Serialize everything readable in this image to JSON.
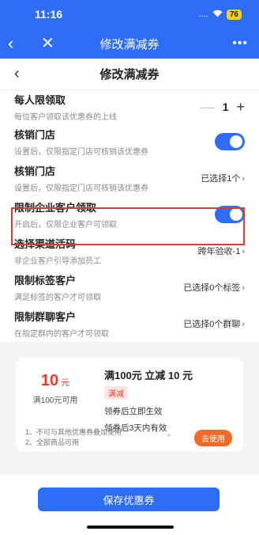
{
  "status": {
    "time": "11:16",
    "signal": "....",
    "battery": "76"
  },
  "app_nav": {
    "title": "修改满减券"
  },
  "page_header": {
    "title": "修改满减券"
  },
  "rows": [
    {
      "label": "每人限领取",
      "desc": "每位客户领取该优惠券的上线",
      "stepper_value": "1"
    },
    {
      "label": "核销门店",
      "desc": "设置后，仅限指定门店可核销该优惠券",
      "toggle": "on"
    },
    {
      "label": "核销门店",
      "desc": "设置后，仅限指定门店可核销该优惠券",
      "value_prefix": "已选择",
      "value_count": "1",
      "value_suffix": "个"
    },
    {
      "label": "限制企业客户领取",
      "desc": "开启后，仅限企业客户可领取",
      "toggle": "on"
    },
    {
      "label": "选择渠道活码",
      "desc": "非企业客户引导添加员工",
      "value": "跨年验收-1"
    },
    {
      "label": "限制标签客户",
      "desc": "满足标签的客户才可领取",
      "value_prefix": "已选择",
      "value_count": "0",
      "value_suffix": "个标签"
    },
    {
      "label": "限制群聊客户",
      "desc": "在指定群内的客户才可领取",
      "value_prefix": "已选择",
      "value_count": "0",
      "value_suffix": "个群聊"
    }
  ],
  "coupon": {
    "amount": "10",
    "unit": "元",
    "condition": "满100元可用",
    "title": "满100元 立减 10 元",
    "tag": "满减",
    "line1": "领券后立即生效",
    "line2": "领券后3天内有效",
    "rule1": "1、不可与其他优惠券叠加使用",
    "rule2": "2、全部商品可用",
    "use_label": "去使用"
  },
  "save_label": "保存优惠券",
  "colors": {
    "primary": "#2f6df6",
    "danger": "#e0392e",
    "accent": "#f06a2a"
  }
}
